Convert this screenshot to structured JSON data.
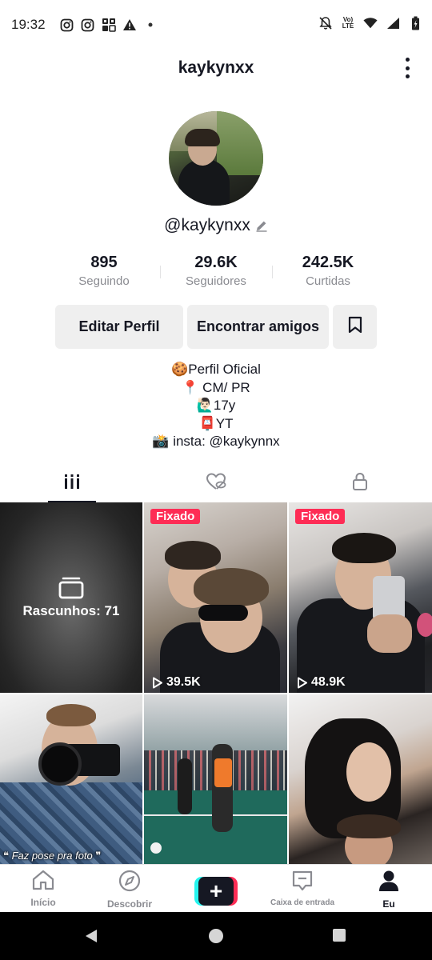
{
  "status_bar": {
    "time": "19:32",
    "lte_top": "Vo)",
    "lte_bottom": "LTE"
  },
  "header": {
    "title": "kaykynxx"
  },
  "profile": {
    "username": "@kaykynxx",
    "stats": [
      {
        "value": "895",
        "label": "Seguindo"
      },
      {
        "value": "29.6K",
        "label": "Seguidores"
      },
      {
        "value": "242.5K",
        "label": "Curtidas"
      }
    ]
  },
  "buttons": {
    "edit": "Editar Perfil",
    "find": "Encontrar amigos"
  },
  "bio": [
    "🍪Perfil Oficial",
    "📍 CM/ PR",
    "🙋🏻‍♂️17y",
    "📮YT",
    "📸 insta: @kaykynnx"
  ],
  "grid": {
    "drafts_label": "Rascunhos: 71",
    "pinned_label": "Fixado",
    "video1_views": "39.5K",
    "video2_views": "48.9K",
    "video3_caption": "❝ Faz pose pra foto ❞"
  },
  "bottom_nav": {
    "home": "Início",
    "discover": "Descobrir",
    "create": "+",
    "inbox": "Caixa de entrada",
    "me": "Eu"
  },
  "colors": {
    "accent": "#fe2c55",
    "cyan": "#25f4ee",
    "text": "#161823",
    "muted": "#8a8b91",
    "button_bg": "#efefef"
  }
}
